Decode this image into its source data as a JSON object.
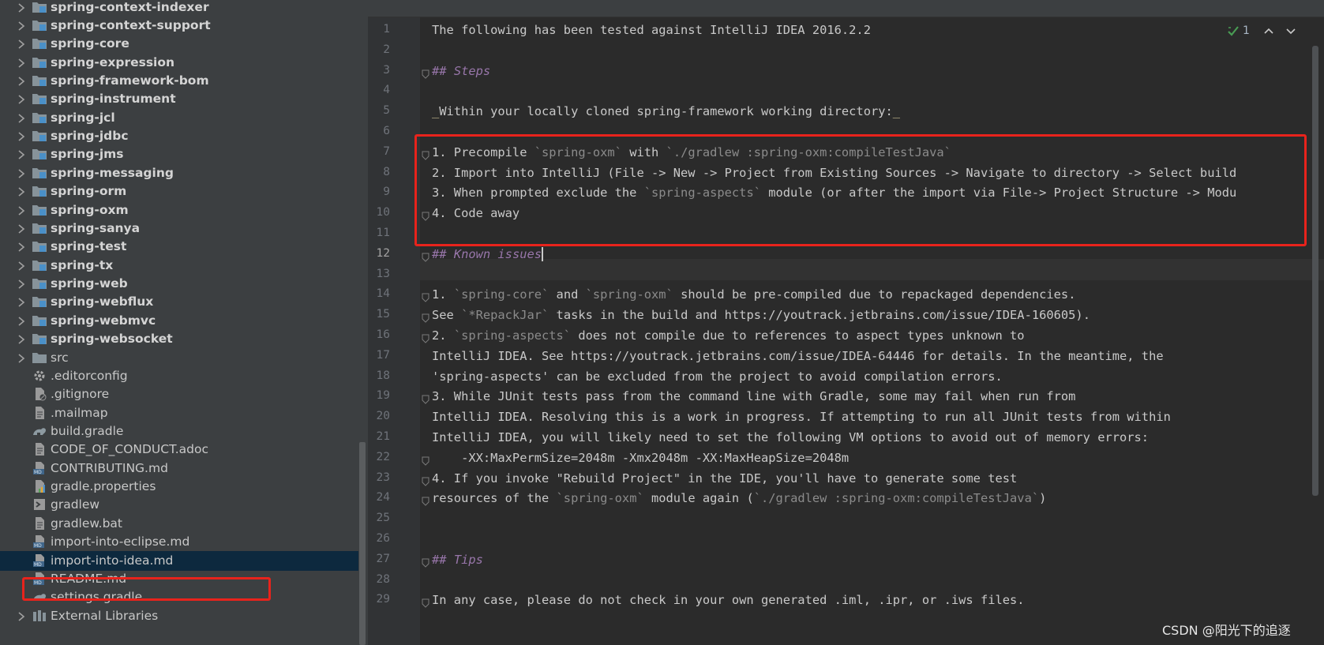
{
  "tree": {
    "items": [
      {
        "label": "spring-context-indexer",
        "kind": "module"
      },
      {
        "label": "spring-context-support",
        "kind": "module"
      },
      {
        "label": "spring-core",
        "kind": "module"
      },
      {
        "label": "spring-expression",
        "kind": "module"
      },
      {
        "label": "spring-framework-bom",
        "kind": "module"
      },
      {
        "label": "spring-instrument",
        "kind": "module"
      },
      {
        "label": "spring-jcl",
        "kind": "module"
      },
      {
        "label": "spring-jdbc",
        "kind": "module"
      },
      {
        "label": "spring-jms",
        "kind": "module"
      },
      {
        "label": "spring-messaging",
        "kind": "module"
      },
      {
        "label": "spring-orm",
        "kind": "module"
      },
      {
        "label": "spring-oxm",
        "kind": "module"
      },
      {
        "label": "spring-sanya",
        "kind": "module"
      },
      {
        "label": "spring-test",
        "kind": "module"
      },
      {
        "label": "spring-tx",
        "kind": "module"
      },
      {
        "label": "spring-web",
        "kind": "module"
      },
      {
        "label": "spring-webflux",
        "kind": "module"
      },
      {
        "label": "spring-webmvc",
        "kind": "module"
      },
      {
        "label": "spring-websocket",
        "kind": "module"
      },
      {
        "label": "src",
        "kind": "folder"
      },
      {
        "label": ".editorconfig",
        "kind": "config"
      },
      {
        "label": ".gitignore",
        "kind": "ignore"
      },
      {
        "label": ".mailmap",
        "kind": "file"
      },
      {
        "label": "build.gradle",
        "kind": "gradle"
      },
      {
        "label": "CODE_OF_CONDUCT.adoc",
        "kind": "file"
      },
      {
        "label": "CONTRIBUTING.md",
        "kind": "md"
      },
      {
        "label": "gradle.properties",
        "kind": "props"
      },
      {
        "label": "gradlew",
        "kind": "shell"
      },
      {
        "label": "gradlew.bat",
        "kind": "file"
      },
      {
        "label": "import-into-eclipse.md",
        "kind": "md"
      },
      {
        "label": "import-into-idea.md",
        "kind": "md",
        "selected": true
      },
      {
        "label": "README.md",
        "kind": "md"
      },
      {
        "label": "settings.gradle",
        "kind": "gradle"
      },
      {
        "label": "External Libraries",
        "kind": "libs"
      }
    ]
  },
  "editor": {
    "inspection_count": "1",
    "current_line": 12,
    "lines": [
      [
        {
          "t": "The following has been tested against IntelliJ IDEA 2016.2.2"
        }
      ],
      [],
      [
        {
          "t": "## ",
          "c": "h"
        },
        {
          "t": "Steps",
          "c": "hi"
        }
      ],
      [],
      [
        {
          "t": "_",
          "c": "e"
        },
        {
          "t": "Within your locally cloned spring-framework working directory:"
        },
        {
          "t": "_",
          "c": "e"
        }
      ],
      [],
      [
        {
          "t": "1. Precompile "
        },
        {
          "t": "`spring-oxm`",
          "c": "c"
        },
        {
          "t": " with "
        },
        {
          "t": "`./gradlew :spring-oxm:compileTestJava`",
          "c": "c"
        }
      ],
      [
        {
          "t": "2. Import into IntelliJ (File -> New -> Project from Existing Sources -> Navigate to directory -> Select build"
        }
      ],
      [
        {
          "t": "3. When prompted exclude the "
        },
        {
          "t": "`spring-aspects`",
          "c": "c"
        },
        {
          "t": " module (or after the import via File-> Project Structure -> Modu"
        }
      ],
      [
        {
          "t": "4. Code away"
        }
      ],
      [],
      [
        {
          "t": "## ",
          "c": "h"
        },
        {
          "t": "Known issues",
          "c": "hi"
        }
      ],
      [],
      [
        {
          "t": "1. "
        },
        {
          "t": "`spring-core`",
          "c": "c"
        },
        {
          "t": " and "
        },
        {
          "t": "`spring-oxm`",
          "c": "c"
        },
        {
          "t": " should be pre-compiled due to repackaged dependencies."
        }
      ],
      [
        {
          "t": "See "
        },
        {
          "t": "`*RepackJar`",
          "c": "c"
        },
        {
          "t": " tasks in the build and https://youtrack.jetbrains.com/issue/IDEA-160605)."
        }
      ],
      [
        {
          "t": "2. "
        },
        {
          "t": "`spring-aspects`",
          "c": "c"
        },
        {
          "t": " does not compile due to references to aspect types unknown to"
        }
      ],
      [
        {
          "t": "IntelliJ IDEA. See https://youtrack.jetbrains.com/issue/IDEA-64446 for details. In the meantime, the"
        }
      ],
      [
        {
          "t": "'spring-aspects' can be excluded from the project to avoid compilation errors."
        }
      ],
      [
        {
          "t": "3. While JUnit tests pass from the command line with Gradle, some may fail when run from"
        }
      ],
      [
        {
          "t": "IntelliJ IDEA. Resolving this is a work in progress. If attempting to run all JUnit tests from within"
        }
      ],
      [
        {
          "t": "IntelliJ IDEA, you will likely need to set the following VM options to avoid out of memory errors:"
        }
      ],
      [
        {
          "t": "    -XX:MaxPermSize=2048m -Xmx2048m -XX:MaxHeapSize=2048m"
        }
      ],
      [
        {
          "t": "4. If you invoke \"Rebuild Project\" in the IDE, you'll have to generate some test"
        }
      ],
      [
        {
          "t": "resources of the "
        },
        {
          "t": "`spring-oxm`",
          "c": "c"
        },
        {
          "t": " module again ("
        },
        {
          "t": "`./gradlew :spring-oxm:compileTestJava`",
          "c": "c"
        },
        {
          "t": ")"
        }
      ],
      [],
      [],
      [
        {
          "t": "## ",
          "c": "h"
        },
        {
          "t": "Tips",
          "c": "hi"
        }
      ],
      [],
      [
        {
          "t": "In any case, please do not check in your own generated .iml, .ipr, or .iws files."
        }
      ]
    ],
    "fold_lines": [
      3,
      7,
      10,
      12,
      14,
      15,
      16,
      19,
      22,
      23,
      24,
      27,
      29
    ]
  },
  "watermark": "CSDN @阳光下的追逐",
  "colors": {
    "tree_bg": "#3c3f41",
    "editor_bg": "#2b2b2b",
    "selection": "#0d293e",
    "annotation_red": "#e8231c",
    "heading": "#9876aa",
    "inline_code": "#8b8b8b",
    "check_green": "#499c54"
  }
}
